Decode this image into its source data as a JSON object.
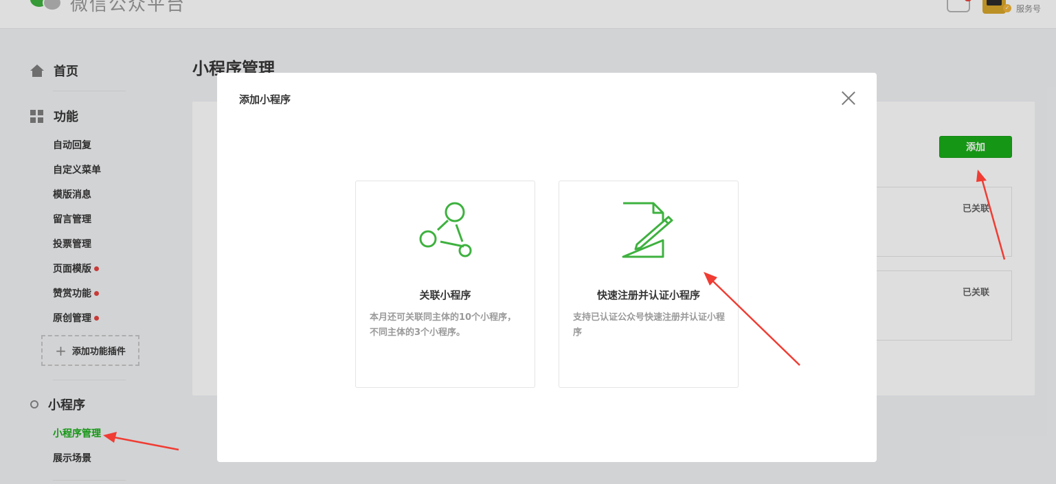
{
  "header": {
    "app_title": "微信公众平台",
    "account_type": "服务号"
  },
  "sidebar": {
    "home_label": "首页",
    "features_label": "功能",
    "feature_items": [
      {
        "label": "自动回复",
        "has_dot": false
      },
      {
        "label": "自定义菜单",
        "has_dot": false
      },
      {
        "label": "模版消息",
        "has_dot": false
      },
      {
        "label": "留言管理",
        "has_dot": false
      },
      {
        "label": "投票管理",
        "has_dot": false
      },
      {
        "label": "页面模版",
        "has_dot": true
      },
      {
        "label": "赞赏功能",
        "has_dot": true
      },
      {
        "label": "原创管理",
        "has_dot": true
      }
    ],
    "add_plugin_label": "添加功能插件",
    "miniprogram_label": "小程序",
    "miniprogram_items": [
      {
        "label": "小程序管理",
        "active": true
      },
      {
        "label": "展示场景",
        "active": false
      }
    ]
  },
  "main": {
    "page_title": "小程序管理",
    "add_button_label": "添加",
    "linked_apps": [
      {
        "status": "已关联"
      },
      {
        "status": "已关联"
      }
    ]
  },
  "dialog": {
    "title": "添加小程序",
    "options": [
      {
        "icon": "share-nodes-icon",
        "title": "关联小程序",
        "description": "本月还可关联同主体的10个小程序，不同主体的3个小程序。"
      },
      {
        "icon": "document-edit-icon",
        "title": "快速注册并认证小程序",
        "description": "支持已认证公众号快速注册并认证小程序"
      }
    ]
  },
  "colors": {
    "accent_green": "#1aad19",
    "icon_green": "#3eb13f",
    "badge_red": "#e64340",
    "annotation_red": "#f03c33"
  }
}
